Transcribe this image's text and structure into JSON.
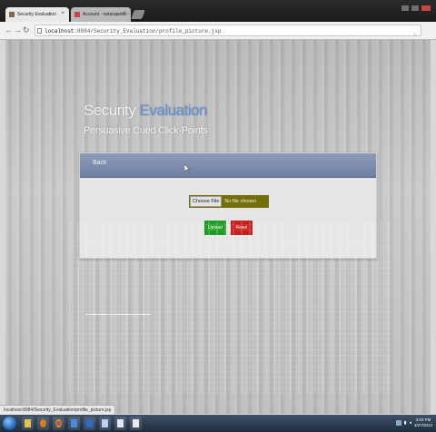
{
  "browser": {
    "tabs": [
      {
        "label": "Security Evaluation",
        "active": true
      },
      {
        "label": "Account - natarajanbv - ",
        "active": false
      }
    ],
    "address": {
      "host": "localhost",
      "path": ":8084/Security_Evaluation/profile_picture.jsp"
    },
    "status_url": "localhost:8084/Security_Evaluation/profile_picture.jsp"
  },
  "page": {
    "title_main": "Security",
    "title_accent": "Evaluation",
    "subtitle": "Persuasive Cued Click-Points",
    "panel": {
      "back_label": "Back",
      "file_input": {
        "button_label": "Choose File",
        "status": "No file chosen"
      },
      "submit_label": "Upload",
      "reset_label": "Reset"
    }
  },
  "taskbar": {
    "clock_time": "4:03 PM",
    "clock_date": "3/27/2014"
  },
  "colors": {
    "header": "#7585a8",
    "accent_title": "#5a8fd8",
    "submit": "#1f9d22",
    "reset": "#c81d1d",
    "file_bg": "#726e0a"
  }
}
